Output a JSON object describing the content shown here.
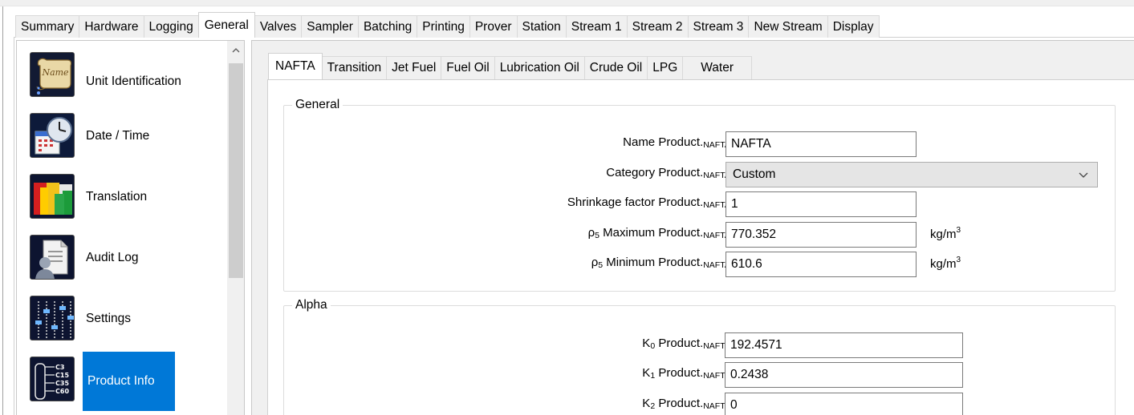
{
  "main_tabs": [
    "Summary",
    "Hardware",
    "Logging",
    "General",
    "Valves",
    "Sampler",
    "Batching",
    "Printing",
    "Prover",
    "Station",
    "Stream 1",
    "Stream 2",
    "Stream 3",
    "New Stream",
    "Display"
  ],
  "main_tabs_active": "General",
  "sidebar": {
    "items": [
      {
        "label": "Unit Identification",
        "icon": "scroll-name-icon"
      },
      {
        "label": "Date / Time",
        "icon": "clock-calendar-icon"
      },
      {
        "label": "Translation",
        "icon": "flags-icon"
      },
      {
        "label": "Audit Log",
        "icon": "audit-document-icon"
      },
      {
        "label": "Settings",
        "icon": "sliders-icon"
      },
      {
        "label": "Product Info",
        "icon": "distillation-column-icon"
      }
    ],
    "selected": "Product Info",
    "icon_text": {
      "scroll": "Name",
      "c3": "C3",
      "c15": "C15",
      "c35": "C35",
      "c60": "C60"
    }
  },
  "product_tabs": [
    "NAFTA",
    "Transition",
    "Jet Fuel",
    "Fuel Oil",
    "Lubrication Oil",
    "Crude Oil",
    "LPG",
    "Water"
  ],
  "product_tabs_active": "NAFTA",
  "general_group": {
    "title": "General",
    "name_label": "Name Product.",
    "name_sub": "NAFTA",
    "name_value": "NAFTA",
    "category_label": "Category Product.",
    "category_sub": "NAFTA",
    "category_value": "Custom",
    "shrinkage_label": "Shrinkage factor Product.",
    "shrinkage_sub": "NAFTA",
    "shrinkage_value": "1",
    "max_label_rho": "ρ",
    "max_label_rho_sub": "5",
    "max_label": " Maximum Product.",
    "max_sub": "NAFTA",
    "max_value": "770.352",
    "max_unit": "kg/m",
    "max_unit_sup": "3",
    "min_label_rho": "ρ",
    "min_label_rho_sub": "5",
    "min_label": " Minimum Product.",
    "min_sub": "NAFTA",
    "min_value": "610.6",
    "min_unit": "kg/m",
    "min_unit_sup": "3"
  },
  "alpha_group": {
    "title": "Alpha",
    "k0_label": "K",
    "k0_idx": "0",
    "k0_rest": " Product.",
    "k0_sub": "NAFTA",
    "k0_value": "192.4571",
    "k1_label": "K",
    "k1_idx": "1",
    "k1_rest": " Product.",
    "k1_sub": "NAFTA",
    "k1_value": "0.2438",
    "k2_label": "K",
    "k2_idx": "2",
    "k2_rest": " Product.",
    "k2_sub": "NAFTA",
    "k2_value": "0"
  },
  "colors": {
    "selection": "#0078d7",
    "panel_bg": "#f0f0f0",
    "border": "#d0d0d0"
  }
}
